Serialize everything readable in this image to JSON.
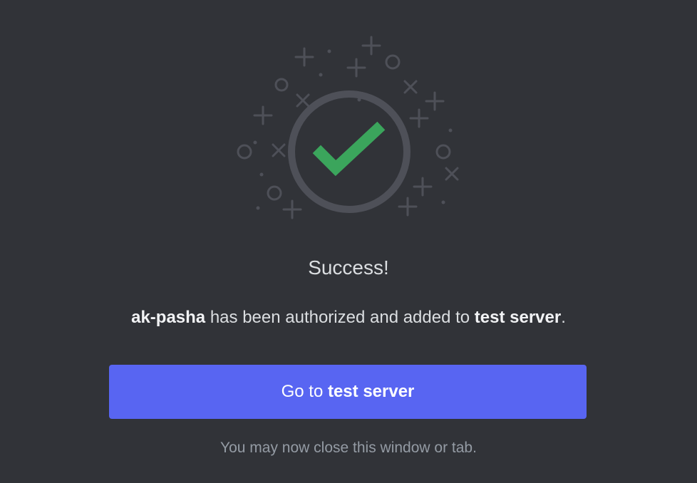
{
  "illustration": {
    "icon": "checkmark-success-icon",
    "ring_color": "#4e5058",
    "check_color": "#3ba55c",
    "sparkle_color": "#4e5058"
  },
  "title": "Success!",
  "message": {
    "app_name": "ak-pasha",
    "middle_text": " has been authorized and added to ",
    "server_name": "test server",
    "end_text": "."
  },
  "button": {
    "prefix": "Go to ",
    "server_name": "test server",
    "color": "#5865f2"
  },
  "footnote": "You may now close this window or tab."
}
